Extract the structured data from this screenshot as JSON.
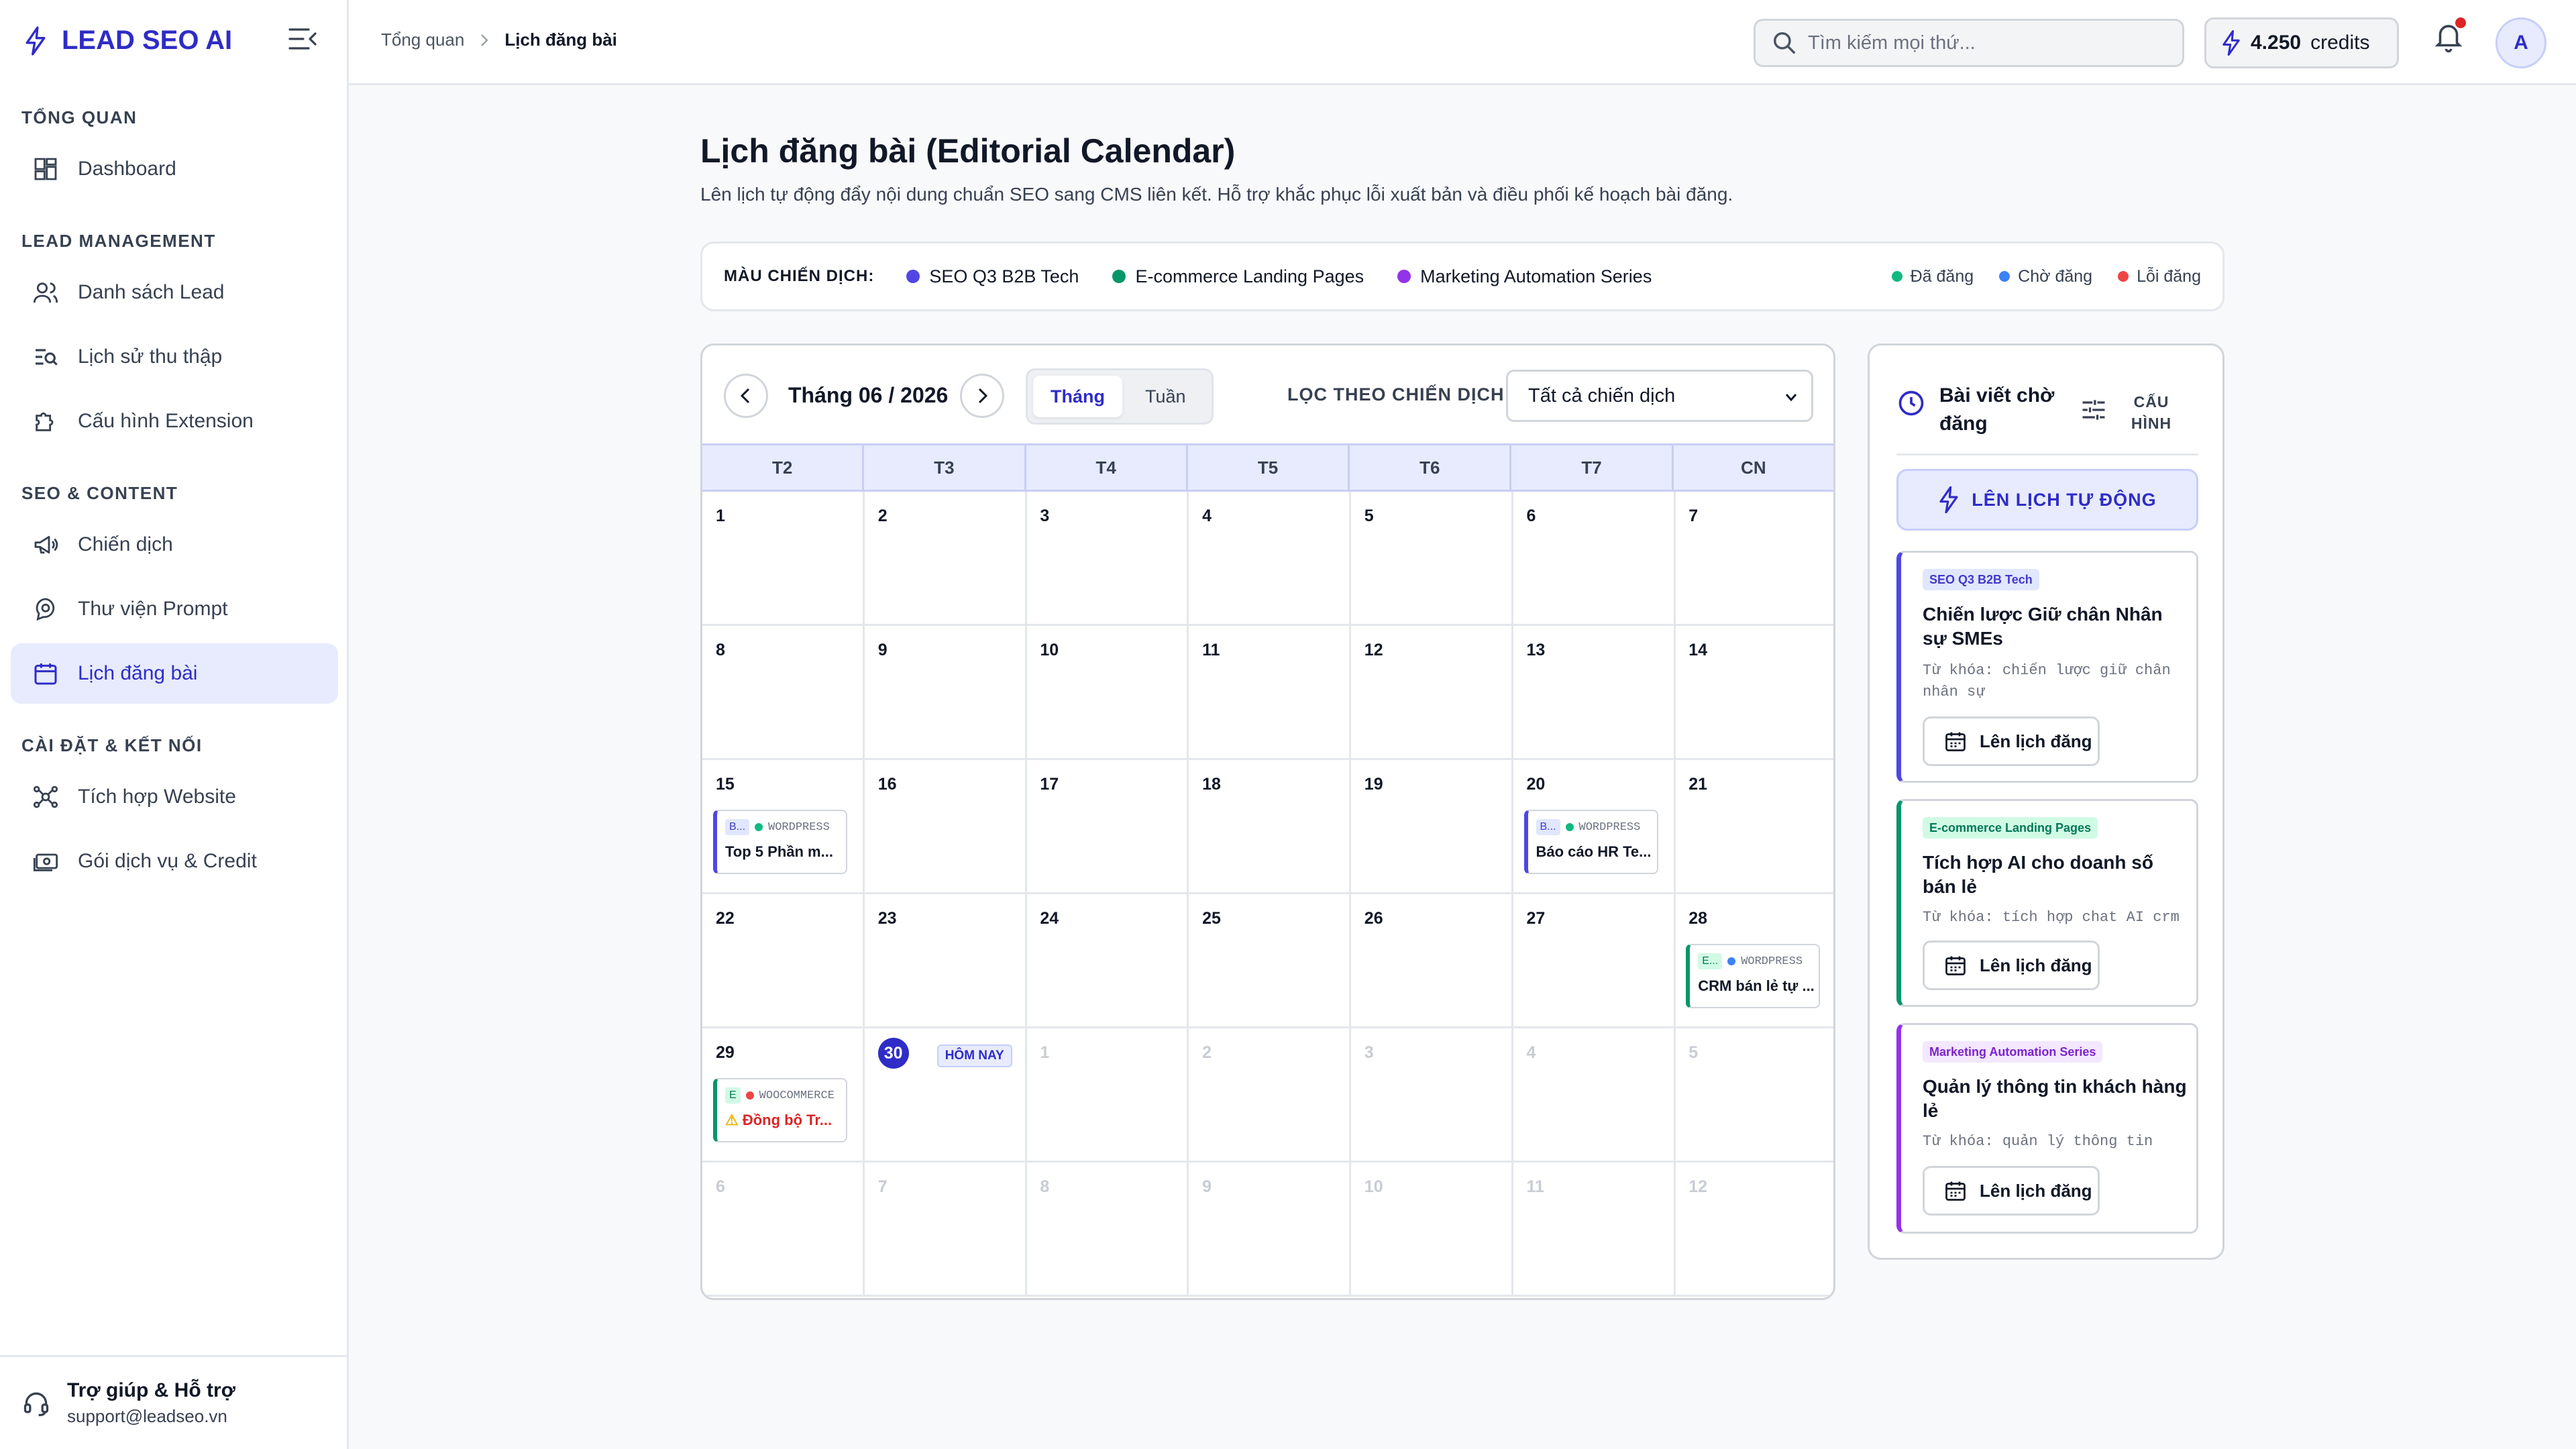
{
  "brand": {
    "name": "LEAD SEO AI",
    "accent": "#2f2cc7"
  },
  "sidebar": {
    "sections": [
      {
        "title": "TỔNG QUAN",
        "items": [
          {
            "label": "Dashboard",
            "icon": "dashboard-icon"
          }
        ]
      },
      {
        "title": "LEAD MANAGEMENT",
        "items": [
          {
            "label": "Danh sách Lead",
            "icon": "users-icon"
          },
          {
            "label": "Lịch sử thu thập",
            "icon": "history-search-icon"
          },
          {
            "label": "Cấu hình Extension",
            "icon": "puzzle-icon"
          }
        ]
      },
      {
        "title": "SEO & CONTENT",
        "items": [
          {
            "label": "Chiến dịch",
            "icon": "megaphone-icon"
          },
          {
            "label": "Thư viện Prompt",
            "icon": "prompt-library-icon"
          },
          {
            "label": "Lịch đăng bài",
            "icon": "calendar-icon",
            "active": true
          }
        ]
      },
      {
        "title": "CÀI ĐẶT & KẾT NỐI",
        "items": [
          {
            "label": "Tích hợp Website",
            "icon": "integration-icon"
          },
          {
            "label": "Gói dịch vụ & Credit",
            "icon": "money-icon"
          }
        ]
      }
    ],
    "help": {
      "title": "Trợ giúp & Hỗ trợ",
      "email": "support@leadseo.vn"
    }
  },
  "header": {
    "breadcrumb": [
      "Tổng quan",
      "Lịch đăng bài"
    ],
    "search_placeholder": "Tìm kiếm mọi thứ...",
    "credits": "4.250",
    "credits_unit": "credits",
    "avatar": "A"
  },
  "page": {
    "title": "Lịch đăng bài (Editorial Calendar)",
    "subtitle": "Lên lịch tự động đẩy nội dung chuẩn SEO sang CMS liên kết. Hỗ trợ khắc phục lỗi xuất bản và điều phối kế hoạch bài đăng."
  },
  "legend": {
    "label": "MÀU CHIẾN DỊCH:",
    "campaigns": [
      {
        "name": "SEO Q3 B2B Tech",
        "color": "#4f46e5"
      },
      {
        "name": "E-commerce Landing Pages",
        "color": "#059669"
      },
      {
        "name": "Marketing Automation Series",
        "color": "#9333ea"
      }
    ],
    "statuses": [
      {
        "name": "Đã đăng",
        "color": "#10b981"
      },
      {
        "name": "Chờ đăng",
        "color": "#3b82f6"
      },
      {
        "name": "Lỗi đăng",
        "color": "#ef4444"
      }
    ]
  },
  "calendar": {
    "month_label": "Tháng 06 / 2026",
    "view_options": [
      "Tháng",
      "Tuần"
    ],
    "active_view": "Tháng",
    "filter_label": "LỌC THEO CHIẾN DỊCH:",
    "filter_value": "Tất cả chiến dịch",
    "weekdays": [
      "T2",
      "T3",
      "T4",
      "T5",
      "T6",
      "T7",
      "CN"
    ],
    "today_badge": "HÔM NAY",
    "weeks": [
      [
        {
          "d": "1"
        },
        {
          "d": "2"
        },
        {
          "d": "3"
        },
        {
          "d": "4"
        },
        {
          "d": "5"
        },
        {
          "d": "6"
        },
        {
          "d": "7"
        }
      ],
      [
        {
          "d": "8"
        },
        {
          "d": "9"
        },
        {
          "d": "10"
        },
        {
          "d": "11"
        },
        {
          "d": "12"
        },
        {
          "d": "13"
        },
        {
          "d": "14"
        }
      ],
      [
        {
          "d": "15",
          "event": {
            "tag": "B...",
            "platform": "WORDPRESS",
            "title": "Top 5 Phần m...",
            "campaign": 0,
            "status": 0
          }
        },
        {
          "d": "16"
        },
        {
          "d": "17"
        },
        {
          "d": "18"
        },
        {
          "d": "19"
        },
        {
          "d": "20",
          "event": {
            "tag": "B...",
            "platform": "WORDPRESS",
            "title": "Báo cáo HR Te...",
            "campaign": 0,
            "status": 0
          }
        },
        {
          "d": "21"
        }
      ],
      [
        {
          "d": "22"
        },
        {
          "d": "23"
        },
        {
          "d": "24"
        },
        {
          "d": "25"
        },
        {
          "d": "26"
        },
        {
          "d": "27"
        },
        {
          "d": "28",
          "event": {
            "tag": "E...",
            "platform": "WORDPRESS",
            "title": "CRM bán lẻ tự ...",
            "campaign": 1,
            "status": 1
          }
        }
      ],
      [
        {
          "d": "29",
          "event": {
            "tag": "E",
            "platform": "WOOCOMMERCE",
            "title": "Đồng bộ Tr...",
            "campaign": 1,
            "status": 2,
            "warning": "⚠"
          }
        },
        {
          "d": "30",
          "today": true
        },
        {
          "d": "1",
          "other": true
        },
        {
          "d": "2",
          "other": true
        },
        {
          "d": "3",
          "other": true
        },
        {
          "d": "4",
          "other": true
        },
        {
          "d": "5",
          "other": true
        }
      ],
      [
        {
          "d": "6",
          "other": true
        },
        {
          "d": "7",
          "other": true
        },
        {
          "d": "8",
          "other": true
        },
        {
          "d": "9",
          "other": true
        },
        {
          "d": "10",
          "other": true
        },
        {
          "d": "11",
          "other": true
        },
        {
          "d": "12",
          "other": true
        }
      ]
    ]
  },
  "pending": {
    "title": "Bài viết chờ đăng",
    "config_label": "CẤU HÌNH",
    "auto_button": "LÊN LỊCH TỰ ĐỘNG",
    "schedule_label": "Lên lịch đăng",
    "cards": [
      {
        "campaign": "SEO Q3 B2B Tech",
        "color": "#4f46e5",
        "tag_bg": "#e0e7ff",
        "title": "Chiến lược Giữ chân Nhân sự SMEs",
        "keywords": "Từ khóa: chiến lược giữ chân nhân sự"
      },
      {
        "campaign": "E-commerce Landing Pages",
        "color": "#059669",
        "tag_bg": "#d1fae5",
        "title": "Tích hợp AI cho doanh số bán lẻ",
        "keywords": "Từ khóa: tích hợp chat AI crm"
      },
      {
        "campaign": "Marketing Automation Series",
        "color": "#9333ea",
        "tag_bg": "#f3e8ff",
        "title": "Quản lý thông tin khách hàng lẻ",
        "keywords": "Từ khóa: quản lý thông tin"
      }
    ]
  }
}
